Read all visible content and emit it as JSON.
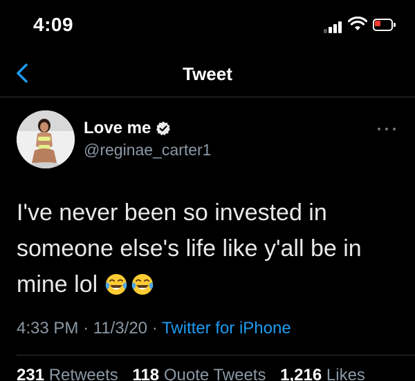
{
  "status_bar": {
    "time": "4:09",
    "battery_color": "#ff3b30"
  },
  "nav": {
    "title": "Tweet",
    "back_icon": "chevron-left-icon",
    "accent": "#1d9bf0"
  },
  "tweet": {
    "display_name": "Love me",
    "verified": true,
    "handle": "@reginae_carter1",
    "text_lines": [
      "I've never been so invested in",
      "someone else's life like y'all be in",
      "mine lol"
    ],
    "emojis": [
      "face-with-tears-of-joy",
      "face-with-tears-of-joy"
    ],
    "time": "4:33 PM",
    "separator": "·",
    "date": "11/3/20",
    "source": "Twitter for iPhone"
  },
  "stats": {
    "retweets_count": "231",
    "retweets_label": "Retweets",
    "quotes_count": "118",
    "quotes_label": "Quote Tweets",
    "likes_count": "1,216",
    "likes_label": "Likes"
  }
}
